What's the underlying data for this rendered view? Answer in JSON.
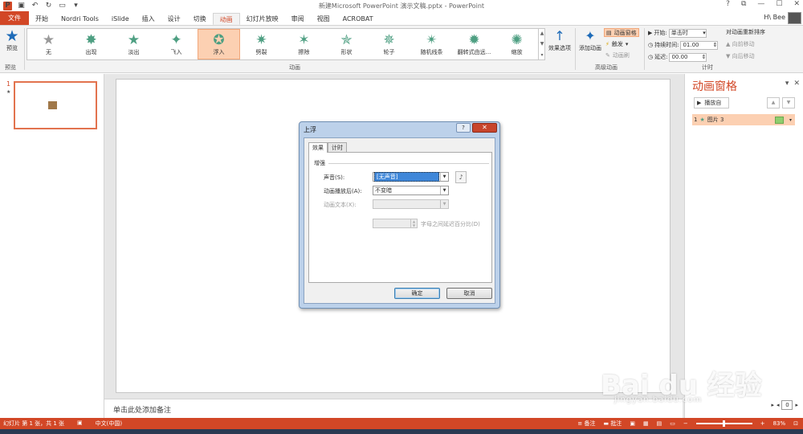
{
  "window": {
    "doc_title": "新建Microsoft PowerPoint 演示文稿.pptx - PowerPoint",
    "controls": [
      "?",
      "⧉",
      "—",
      "☐",
      "✕"
    ],
    "user": "H\\ Bee"
  },
  "ribbon_tabs": [
    "文件",
    "开始",
    "Nordri Tools",
    "iSlide",
    "插入",
    "设计",
    "切换",
    "动画",
    "幻灯片放映",
    "审阅",
    "视图",
    "ACROBAT"
  ],
  "ribbon": {
    "preview_label": "预览",
    "preview_group": "预览",
    "animation_group": "动画",
    "advanced_group": "高级动画",
    "timing_group": "计时",
    "effects": [
      {
        "label": "无",
        "icon": "star-icon",
        "style": "grey"
      },
      {
        "label": "出现",
        "icon": "star-burst-icon",
        "style": "green"
      },
      {
        "label": "淡出",
        "icon": "star-icon",
        "style": "green"
      },
      {
        "label": "飞入",
        "icon": "star-fly-icon",
        "style": "green"
      },
      {
        "label": "浮入",
        "icon": "star-float-icon",
        "style": "active"
      },
      {
        "label": "劈裂",
        "icon": "star-split-icon",
        "style": "green"
      },
      {
        "label": "擦除",
        "icon": "star-wipe-icon",
        "style": "green"
      },
      {
        "label": "形状",
        "icon": "star-shape-icon",
        "style": "green"
      },
      {
        "label": "轮子",
        "icon": "star-wheel-icon",
        "style": "green"
      },
      {
        "label": "随机线条",
        "icon": "star-lines-icon",
        "style": "green"
      },
      {
        "label": "翻转式由远...",
        "icon": "star-flip-icon",
        "style": "green"
      },
      {
        "label": "缩放",
        "icon": "star-zoom-icon",
        "style": "green"
      }
    ],
    "effect_options": "效果选项",
    "add_animation": "添加动画",
    "animation_pane": "动画窗格",
    "trigger": "触发",
    "animation_painter": "动画刷",
    "start_label": "开始:",
    "start_value": "单击时",
    "duration_label": "持续时间:",
    "duration_value": "01.00",
    "delay_label": "延迟:",
    "delay_value": "00.00",
    "reorder_title": "对动画重新排序",
    "move_earlier": "向前移动",
    "move_later": "向后移动"
  },
  "slides_panel": {
    "number": "1",
    "star": "★"
  },
  "notes_placeholder": "单击此处添加备注",
  "anim_pane": {
    "title": "动画窗格",
    "play_label": "播放自",
    "item_number": "1",
    "item_label": "图片 3"
  },
  "dialog": {
    "title": "上浮",
    "help": "?",
    "close": "✕",
    "tabs": [
      "效果",
      "计时"
    ],
    "section": "增强",
    "sound_label": "声音(S):",
    "sound_value": "[无声音]",
    "after_label": "动画播放后(A):",
    "after_value": "不变暗",
    "text_label": "动画文本(X):",
    "text_value": "",
    "delay_between_label": "字母之间延迟百分比(D)",
    "ok": "确定",
    "cancel": "取消"
  },
  "status": {
    "slide_info": "幻灯片 第 1 张，共 1 张",
    "language": "中文(中国)",
    "notes": "备注",
    "comments": "批注",
    "zoom": "83%",
    "nav_value": "0"
  },
  "watermark": {
    "main": "Bai du 经验",
    "sub": "jingyan.baidu.com"
  },
  "colors": {
    "accent": "#d24726",
    "highlight": "#fcd0b2",
    "effect_green": "#4e9f82"
  }
}
